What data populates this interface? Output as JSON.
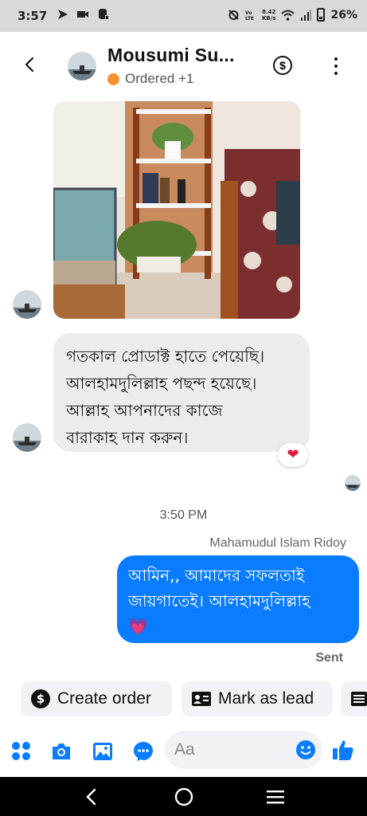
{
  "status_bar": {
    "time": "3:57",
    "net_speed_value": "8.42",
    "net_speed_unit": "KB/s",
    "battery": "26%"
  },
  "header": {
    "contact_name": "Mousumi Su...",
    "status_text": "Ordered +1",
    "status_color": "#f5922e"
  },
  "messages": {
    "incoming_text_lines": [
      "গতকাল প্রোডাক্ট হাতে পেয়েছি।",
      "আলহামদুলিল্লাহ পছন্দ হয়েছে।",
      "আল্লাহ আপনাদের কাজে",
      "বারাকাহ দান করুন।"
    ],
    "reaction": "❤",
    "timestamp": "3:50 PM",
    "outgoing_sender": "Mahamudul Islam Ridoy",
    "outgoing_text_lines": [
      "আমিন,, আমাদের সফলতাই",
      "জায়গাতেই। আলহামদুলিল্লাহ",
      "💗"
    ],
    "delivery_status": "Sent"
  },
  "actions": {
    "create_order": "Create order",
    "mark_as_lead": "Mark as lead"
  },
  "composer": {
    "placeholder": "Aa"
  },
  "colors": {
    "accent": "#0a7cff",
    "incoming_bubble": "#ececec"
  },
  "icons": [
    "back-icon",
    "dollar-icon",
    "kebab-icon",
    "apps-icon",
    "camera-icon",
    "gallery-icon",
    "messenger-icon",
    "emoji-icon",
    "like-icon"
  ]
}
